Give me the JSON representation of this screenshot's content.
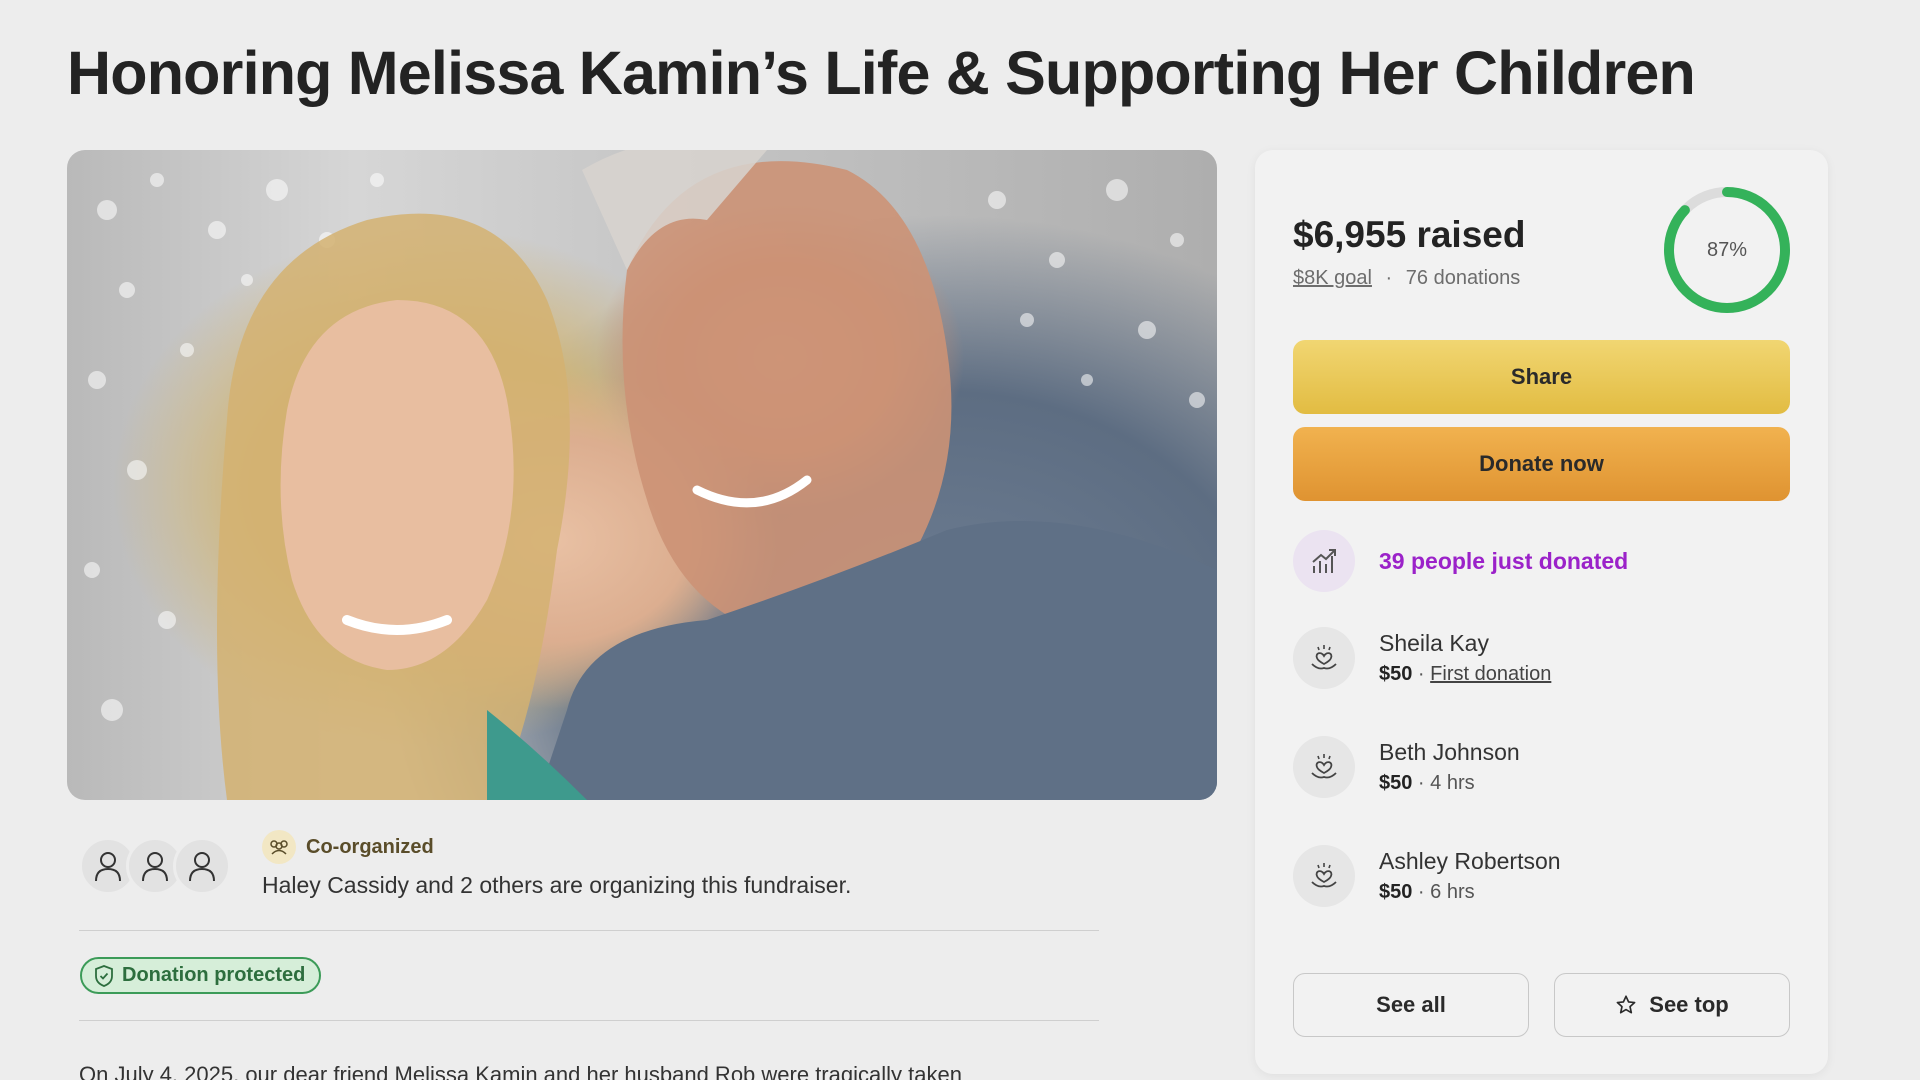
{
  "page": {
    "title": "Honoring Melissa Kamin’s Life & Supporting Her Children"
  },
  "organizers": {
    "badge_label": "Co-organized",
    "text": "Haley Cassidy and 2 others are organizing this fundraiser.",
    "avatar_count": 3
  },
  "protection": {
    "label": "Donation protected"
  },
  "story": {
    "first_line": "On July 4, 2025, our dear friend Melissa Kamin and her husband Rob were tragically taken"
  },
  "donation_card": {
    "raised": "$6,955 raised",
    "goal": "$8K goal",
    "separator": "·",
    "donation_count": "76 donations",
    "progress_label": "87%",
    "progress_value": 0.87,
    "share_label": "Share",
    "donate_label": "Donate now",
    "recent_activity": "39 people just donated",
    "donors": [
      {
        "name": "Sheila Kay",
        "amount": "$50",
        "detail": "First donation"
      },
      {
        "name": "Beth Johnson",
        "amount": "$50",
        "detail": "4 hrs"
      },
      {
        "name": "Ashley Robertson",
        "amount": "$50",
        "detail": "6 hrs"
      }
    ],
    "see_all_label": "See all",
    "see_top_label": "See top"
  },
  "colors": {
    "background": "#ededed",
    "progress_ring": "#34b25a",
    "share_button": "#e9c858",
    "donate_button": "#e8a240",
    "activity_text": "#9b22c9",
    "protected_badge": "#3c9b58"
  }
}
